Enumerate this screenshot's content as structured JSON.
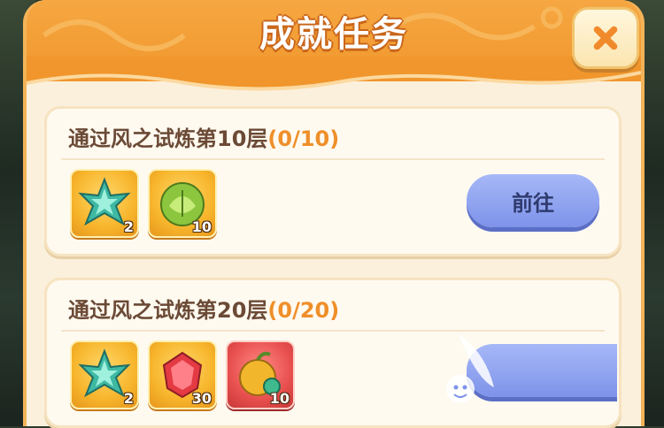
{
  "header": {
    "title": "成就任务"
  },
  "tasks": [
    {
      "title": "通过风之试炼第10层",
      "progress": "(0/10)",
      "button_label": "前往",
      "rewards": [
        {
          "icon": "green-star-crystal-icon",
          "count": "2"
        },
        {
          "icon": "cabbage-icon",
          "count": "10"
        }
      ]
    },
    {
      "title": "通过风之试炼第20层",
      "progress": "(0/20)",
      "button_label": "",
      "rewards": [
        {
          "icon": "green-star-crystal-icon",
          "count": "2"
        },
        {
          "icon": "red-gem-icon",
          "count": "30"
        },
        {
          "icon": "golden-fruit-icon",
          "count": "10"
        }
      ]
    }
  ],
  "colors": {
    "header_orange": "#f0962c",
    "panel_cream": "#fbf0dc",
    "progress_orange": "#ef8f2a",
    "button_blue": "#8fa4f0"
  }
}
